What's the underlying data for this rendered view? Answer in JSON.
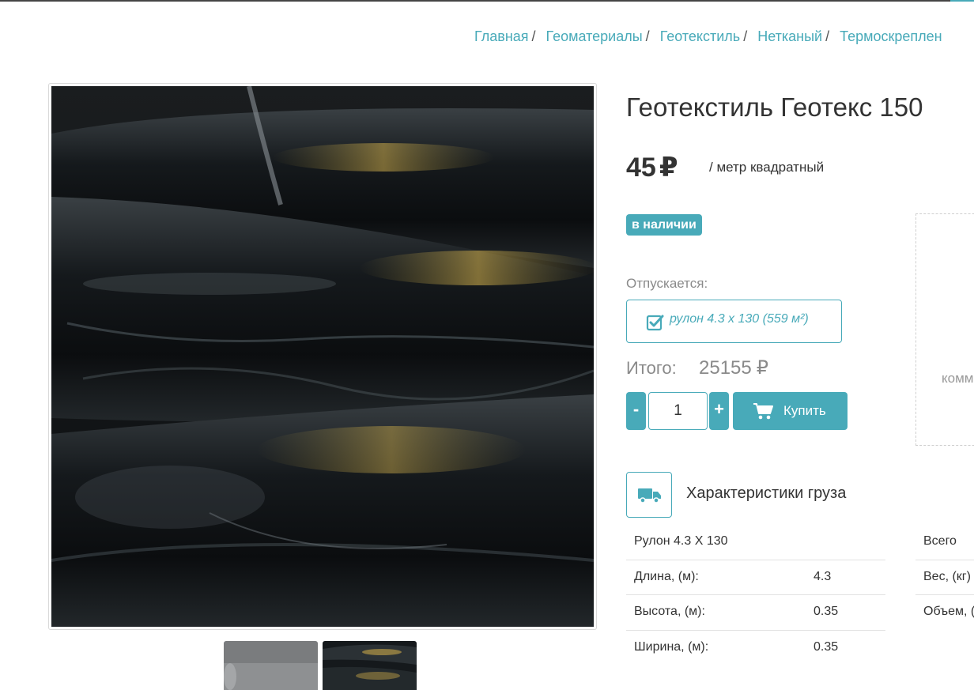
{
  "breadcrumb": [
    {
      "label": "Главная"
    },
    {
      "label": "Геоматериалы"
    },
    {
      "label": "Геотекстиль"
    },
    {
      "label": "Нетканый"
    },
    {
      "label": "Термоскреплен"
    }
  ],
  "product": {
    "title": "Геотекстиль Геотекс 150",
    "price": "45",
    "currency": "₽",
    "unit": "/ метр квадратный",
    "stock_badge": "в наличии",
    "release_label": "Отпускается:",
    "option": "рулон 4.3 х 130 (559 м²)",
    "total_label": "Итого:",
    "total_value": "25155",
    "quantity": "1",
    "minus": "-",
    "plus": "+",
    "buy_label": "Купить"
  },
  "side_panel": {
    "text": "комм"
  },
  "cargo": {
    "title": "Характеристики груза",
    "roll_header": "Рулон 4.3 X 130",
    "rows": [
      {
        "key": "Длина, (м):",
        "value": "4.3"
      },
      {
        "key": "Высота, (м):",
        "value": "0.35"
      },
      {
        "key": "Ширина, (м):",
        "value": "0.35"
      }
    ],
    "total_header": "Всего",
    "total_rows": [
      {
        "key": "Вес, (кг)"
      },
      {
        "key": "Объем, ("
      }
    ]
  },
  "colors": {
    "accent": "#48aab9",
    "text": "#333333",
    "muted": "#8a8a8a"
  },
  "icons": [
    "check-square-icon",
    "shopping-cart-icon",
    "truck-icon"
  ]
}
